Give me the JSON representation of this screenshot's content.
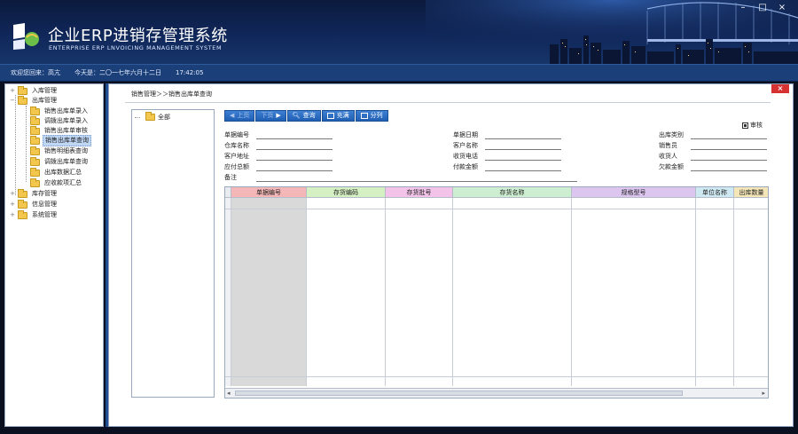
{
  "app": {
    "title": "企业ERP进销存管理系统",
    "subtitle": "ENTERPRISE ERP LNVOICING MANAGEMENT SYSTEM",
    "minimize": "–",
    "maximize": "□",
    "close": "×"
  },
  "status": {
    "welcome": "欢迎您回来：高亢",
    "today": "今天是：二〇一七年六月十二日",
    "time": "17:42:05"
  },
  "nav": [
    {
      "label": "入库管理",
      "expander": "+",
      "level": 0
    },
    {
      "label": "出库管理",
      "expander": "−",
      "level": 0
    },
    {
      "label": "销售出库单录入",
      "level": 1
    },
    {
      "label": "调拨出库单录入",
      "level": 1
    },
    {
      "label": "销售出库单审核",
      "level": 1
    },
    {
      "label": "销售出库单查询",
      "level": 1,
      "selected": true
    },
    {
      "label": "销售明细表查询",
      "level": 1
    },
    {
      "label": "调拨出库单查询",
      "level": 1
    },
    {
      "label": "出库数据汇总",
      "level": 1
    },
    {
      "label": "应收款项汇总",
      "level": 1
    },
    {
      "label": "库存管理",
      "expander": "+",
      "level": 0
    },
    {
      "label": "信息管理",
      "expander": "+",
      "level": 0
    },
    {
      "label": "系统管理",
      "expander": "+",
      "level": 0
    }
  ],
  "breadcrumb": "销售管理＞＞销售出库单查询",
  "panel_close": "×",
  "tree2_root": "全部",
  "toolbar": {
    "prev": "上页",
    "next": "下页",
    "query": "查询",
    "fill": "充满",
    "split": "分列"
  },
  "audit_label": "审核",
  "form": {
    "col1": [
      "单据编号",
      "仓库名称",
      "客户地址",
      "应付总额",
      "备注"
    ],
    "col2": [
      "单据日期",
      "客户名称",
      "收货电话",
      "付款金额"
    ],
    "col3": [
      "出库类别",
      "销售员",
      "收货人",
      "欠款金额"
    ]
  },
  "grid": {
    "columns": [
      {
        "label": "单据编号",
        "color": "#f4b6b6"
      },
      {
        "label": "存货编码",
        "color": "#d5f0c2"
      },
      {
        "label": "存货批号",
        "color": "#f3c3ea"
      },
      {
        "label": "存货名称",
        "color": "#cdeed0"
      },
      {
        "label": "规格型号",
        "color": "#dcc6f0"
      },
      {
        "label": "单位名称",
        "color": "#cfe9f3"
      },
      {
        "label": "出库数量",
        "color": "#f5e6b8"
      }
    ]
  },
  "colors": {
    "banner": "#10275a",
    "statusbar": "#1b3f78",
    "button": "#2a6cc2",
    "selected": "#bfd7f5"
  }
}
